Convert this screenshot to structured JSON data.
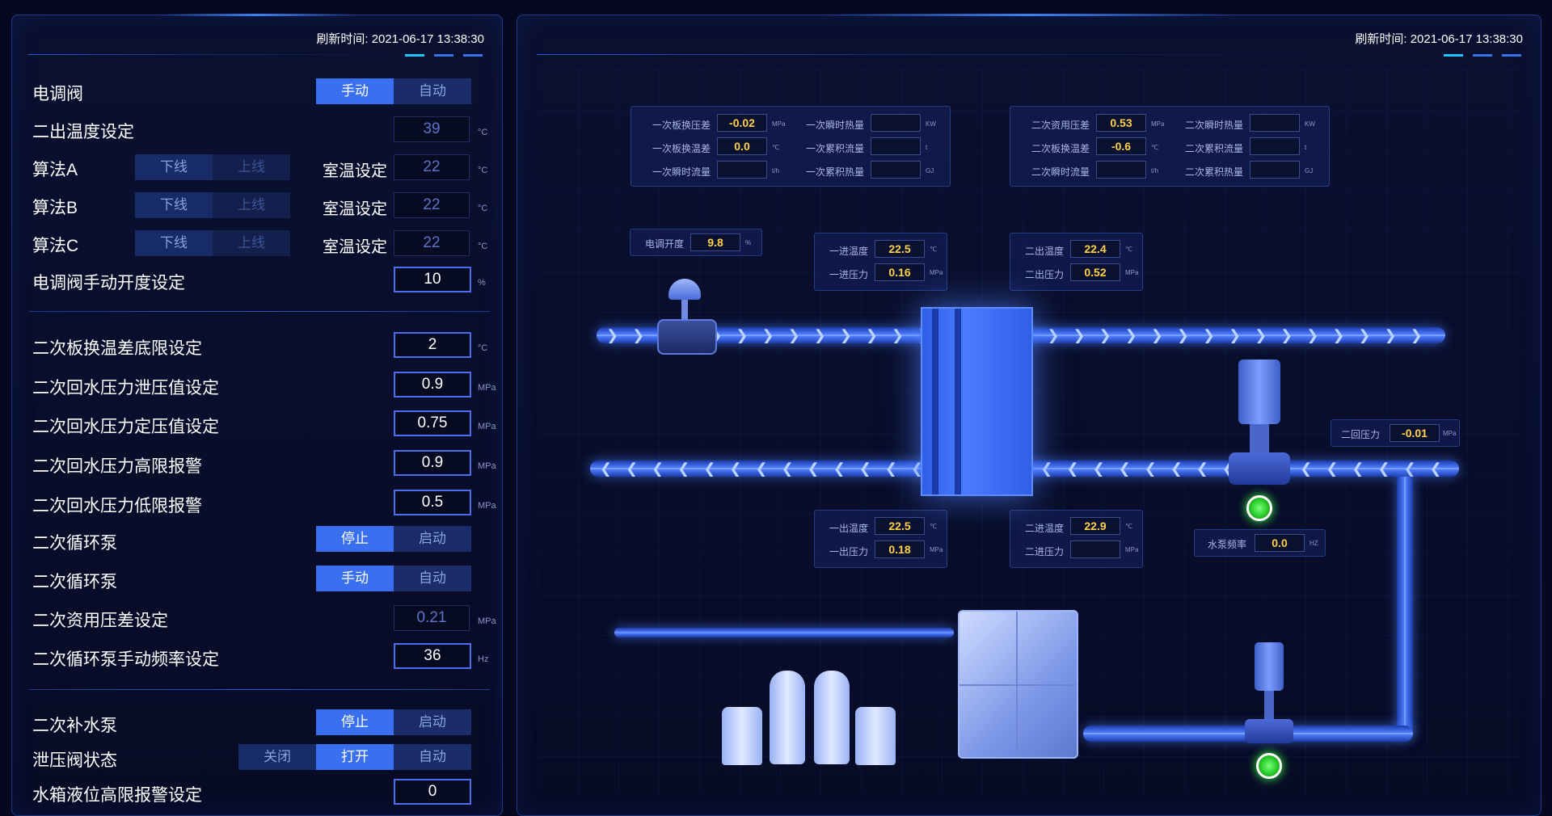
{
  "left_panel": {
    "refresh_time": "刷新时间: 2021-06-17 13:38:30",
    "electric_valve": {
      "label": "电调阀",
      "opt1": "手动",
      "opt2": "自动"
    },
    "outlet_temp_setting": {
      "label": "二出温度设定",
      "value": "39",
      "unit": "°C"
    },
    "algo_a": {
      "label": "算法A",
      "opt1": "下线",
      "opt2": "上线",
      "room_label": "室温设定",
      "value": "22",
      "unit": "°C"
    },
    "algo_b": {
      "label": "算法B",
      "opt1": "下线",
      "opt2": "上线",
      "room_label": "室温设定",
      "value": "22",
      "unit": "°C"
    },
    "algo_c": {
      "label": "算法C",
      "opt1": "下线",
      "opt2": "上线",
      "room_label": "室温设定",
      "value": "22",
      "unit": "°C"
    },
    "valve_manual_open": {
      "label": "电调阀手动开度设定",
      "value": "10",
      "unit": "%"
    },
    "plate_temp_diff_low": {
      "label": "二次板换温差底限设定",
      "value": "2",
      "unit": "°C"
    },
    "return_pressure_relief": {
      "label": "二次回水压力泄压值设定",
      "value": "0.9",
      "unit": "MPa"
    },
    "return_pressure_set": {
      "label": "二次回水压力定压值设定",
      "value": "0.75",
      "unit": "MPa"
    },
    "return_pressure_high_alarm": {
      "label": "二次回水压力高限报警",
      "value": "0.9",
      "unit": "MPa"
    },
    "return_pressure_low_alarm": {
      "label": "二次回水压力低限报警",
      "value": "0.5",
      "unit": "MPa"
    },
    "circ_pump_run": {
      "label": "二次循环泵",
      "opt1": "停止",
      "opt2": "启动"
    },
    "circ_pump_mode": {
      "label": "二次循环泵",
      "opt1": "手动",
      "opt2": "自动"
    },
    "pressure_diff_setting": {
      "label": "二次资用压差设定",
      "value": "0.21",
      "unit": "MPa"
    },
    "pump_manual_freq": {
      "label": "二次循环泵手动频率设定",
      "value": "36",
      "unit": "Hz"
    },
    "makeup_pump": {
      "label": "二次补水泵",
      "opt1": "停止",
      "opt2": "启动"
    },
    "relief_valve": {
      "label": "泄压阀状态",
      "opt1": "关闭",
      "opt2": "打开",
      "opt3": "自动"
    },
    "tank_level_high": {
      "label": "水箱液位高限报警设定",
      "value": "0"
    }
  },
  "right_panel": {
    "refresh_time": "刷新时间: 2021-06-17 13:38:30",
    "primary_box": {
      "plate_pressure_diff": {
        "label": "一次板换压差",
        "value": "-0.02",
        "unit": "MPa"
      },
      "plate_temp_diff": {
        "label": "一次板换温差",
        "value": "0.0",
        "unit": "℃"
      },
      "instant_flow": {
        "label": "一次瞬时流量",
        "value": "",
        "unit": "t/h"
      },
      "instant_heat": {
        "label": "一次瞬时热量",
        "value": "",
        "unit": "KW"
      },
      "total_flow": {
        "label": "一次累积流量",
        "value": "",
        "unit": "t"
      },
      "total_heat": {
        "label": "一次累积热量",
        "value": "",
        "unit": "GJ"
      }
    },
    "secondary_box": {
      "usable_pressure_diff": {
        "label": "二次资用压差",
        "value": "0.53",
        "unit": "MPa"
      },
      "plate_temp_diff": {
        "label": "二次板换温差",
        "value": "-0.6",
        "unit": "℃"
      },
      "instant_flow": {
        "label": "二次瞬时流量",
        "value": "",
        "unit": "t/h"
      },
      "instant_heat": {
        "label": "二次瞬时热量",
        "value": "",
        "unit": "KW"
      },
      "total_flow": {
        "label": "二次累积流量",
        "value": "",
        "unit": "t"
      },
      "total_heat": {
        "label": "二次累积热量",
        "value": "",
        "unit": "GJ"
      }
    },
    "valve_open": {
      "label": "电调开度",
      "value": "9.8",
      "unit": "%"
    },
    "primary_inlet": {
      "temp_label": "一进温度",
      "temp": "22.5",
      "temp_unit": "℃",
      "pres_label": "一进压力",
      "pres": "0.16",
      "pres_unit": "MPa"
    },
    "secondary_outlet": {
      "temp_label": "二出温度",
      "temp": "22.4",
      "temp_unit": "℃",
      "pres_label": "二出压力",
      "pres": "0.52",
      "pres_unit": "MPa"
    },
    "primary_outlet": {
      "temp_label": "一出温度",
      "temp": "22.5",
      "temp_unit": "℃",
      "pres_label": "一出压力",
      "pres": "0.18",
      "pres_unit": "MPa"
    },
    "secondary_inlet": {
      "temp_label": "二进温度",
      "temp": "22.9",
      "temp_unit": "℃",
      "pres_label": "二进压力",
      "pres": "",
      "pres_unit": "MPa"
    },
    "return_pressure": {
      "label": "二回压力",
      "value": "-0.01",
      "unit": "MPa"
    },
    "pump_freq": {
      "label": "水泵频率",
      "value": "0.0",
      "unit": "HZ"
    },
    "chevrons_right": "❯ ❯ ❯ ❯ ❯ ❯ ❯ ❯ ❯ ❯ ❯ ❯ ❯ ❯ ❯ ❯ ❯ ❯ ❯ ❯ ❯ ❯ ❯ ❯ ❯ ❯ ❯ ❯ ❯ ❯ ❯ ❯ ❯ ❯ ❯ ❯",
    "chevrons_left": "❮ ❮ ❮ ❮ ❮ ❮ ❮ ❮ ❮ ❮ ❮ ❮ ❮ ❮ ❮ ❮ ❮ ❮ ❮ ❮ ❮ ❮ ❮ ❮ ❮ ❮ ❮ ❮ ❮ ❮ ❮ ❮ ❮ ❮ ❮ ❮",
    "chevron_up": "︿"
  },
  "colors": {
    "accent": "#3a6ff0",
    "value_yellow": "#ffd24a",
    "run_green": "#2ed12e",
    "pipe_blue": "#4f7dff"
  }
}
